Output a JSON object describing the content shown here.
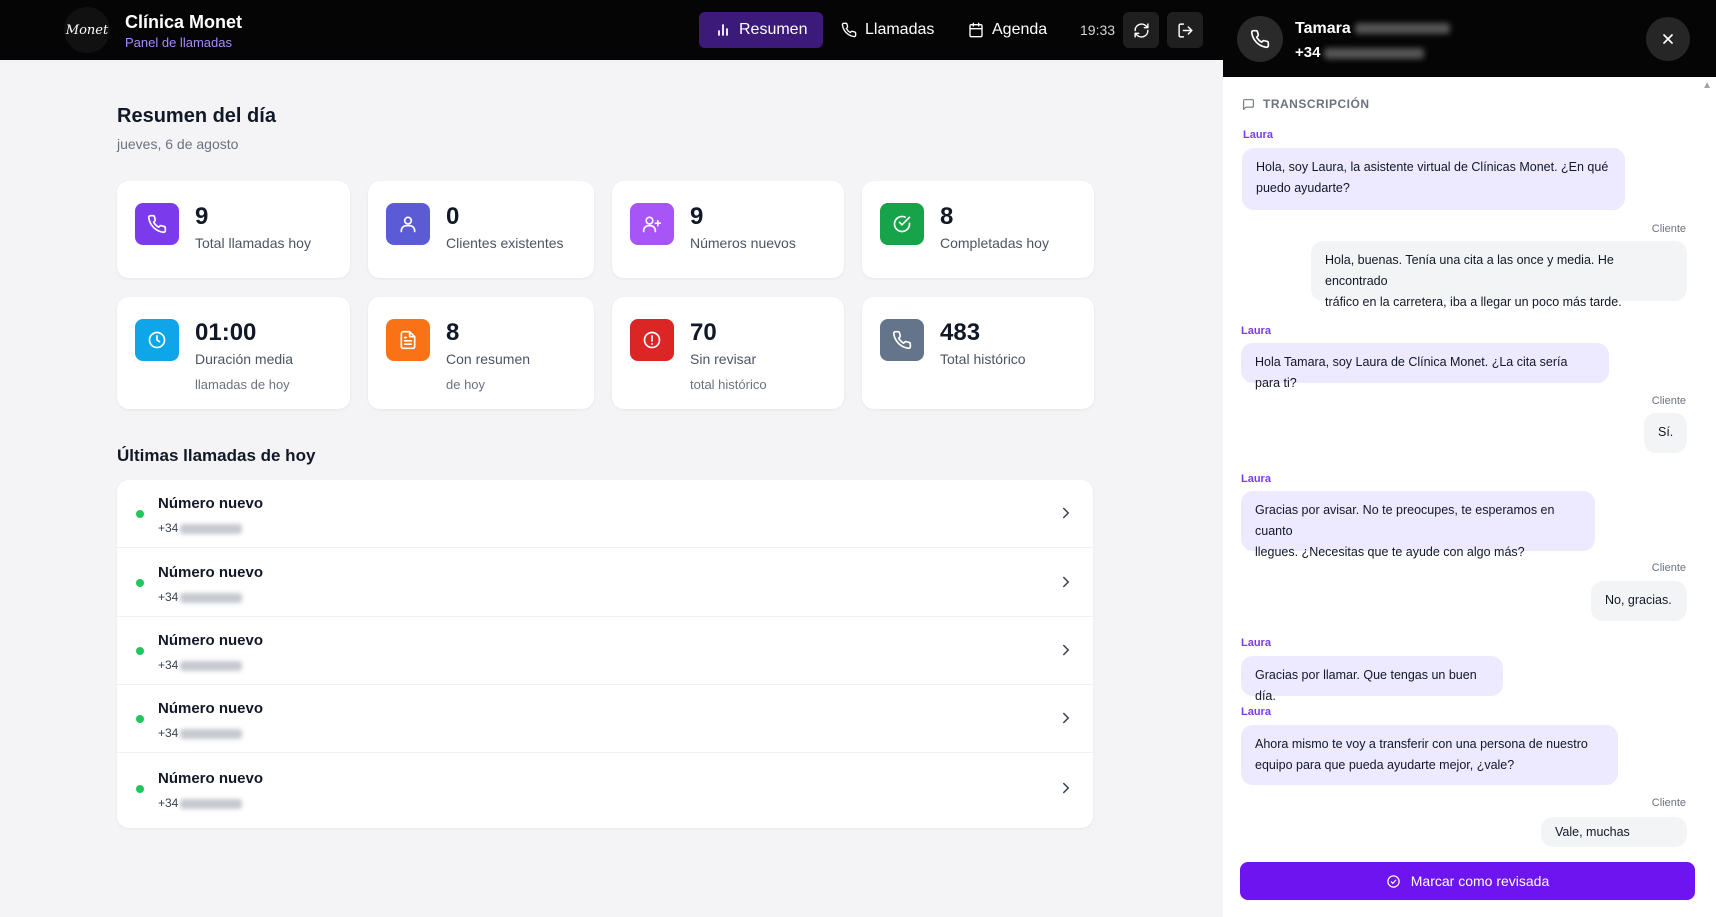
{
  "header": {
    "logo_text": "Monet",
    "app_title": "Clínica Monet",
    "subtitle": "Panel de llamadas",
    "nav": [
      {
        "label": "Resumen",
        "icon": "bar-chart-icon"
      },
      {
        "label": "Llamadas",
        "icon": "phone-icon"
      },
      {
        "label": "Agenda",
        "icon": "calendar-icon"
      }
    ],
    "time": "19:33",
    "active_color": "#3b1a7a"
  },
  "summary": {
    "title": "Resumen del día",
    "date": "jueves, 6 de agosto",
    "stats": [
      {
        "value": "9",
        "label": "Total llamadas hoy",
        "sub": "",
        "icon": "phone-icon",
        "color": "#7c3aed"
      },
      {
        "value": "0",
        "label": "Clientes existentes",
        "sub": "",
        "icon": "user-icon",
        "color": "#5b5bd6"
      },
      {
        "value": "9",
        "label": "Números nuevos",
        "sub": "",
        "icon": "user-plus-icon",
        "color": "#a855f7"
      },
      {
        "value": "8",
        "label": "Completadas hoy",
        "sub": "",
        "icon": "check-circle-icon",
        "color": "#16a34a"
      },
      {
        "value": "01:00",
        "label": "Duración media",
        "sub": "llamadas de hoy",
        "icon": "clock-icon",
        "color": "#0ea5e9"
      },
      {
        "value": "8",
        "label": "Con resumen",
        "sub": "de hoy",
        "icon": "document-icon",
        "color": "#f97316"
      },
      {
        "value": "70",
        "label": "Sin revisar",
        "sub": "total histórico",
        "icon": "alert-icon",
        "color": "#dc2626"
      },
      {
        "value": "483",
        "label": "Total histórico",
        "sub": "",
        "icon": "phone-icon",
        "color": "#64748b"
      }
    ]
  },
  "recent": {
    "title": "Últimas llamadas de hoy",
    "calls": [
      {
        "name": "Número nuevo",
        "prefix": "+34"
      },
      {
        "name": "Número nuevo",
        "prefix": "+34"
      },
      {
        "name": "Número nuevo",
        "prefix": "+34"
      },
      {
        "name": "Número nuevo",
        "prefix": "+34"
      },
      {
        "name": "Número nuevo",
        "prefix": "+34"
      }
    ]
  },
  "panel": {
    "caller_name": "Tamara",
    "caller_phone_prefix": "+34",
    "transcript_label": "TRANSCRIPCIÓN",
    "messages": [
      {
        "speaker": "Laura",
        "role": "bot",
        "lines": [
          "Hola, soy Laura, la asistente virtual de Clínicas Monet. ¿En qué",
          "puedo ayudarte?"
        ]
      },
      {
        "speaker": "Cliente",
        "role": "client",
        "lines": [
          "Hola, buenas. Tenía una cita a las once y media. He encontrado",
          "tráfico en la carretera, iba a llegar un poco más tarde."
        ]
      },
      {
        "speaker": "Laura",
        "role": "bot",
        "lines": [
          "Hola Tamara, soy Laura de Clínica Monet. ¿La cita sería para ti?"
        ]
      },
      {
        "speaker": "Cliente",
        "role": "client",
        "lines": [
          "Sí."
        ]
      },
      {
        "speaker": "Laura",
        "role": "bot",
        "lines": [
          "Gracias por avisar. No te preocupes, te esperamos en cuanto",
          "llegues. ¿Necesitas que te ayude con algo más?"
        ]
      },
      {
        "speaker": "Cliente",
        "role": "client",
        "lines": [
          "No, gracias."
        ]
      },
      {
        "speaker": "Laura",
        "role": "bot",
        "lines": [
          "Gracias por llamar. Que tengas un buen día."
        ]
      },
      {
        "speaker": "Laura",
        "role": "bot",
        "lines": [
          "Ahora mismo te voy a transferir con una persona de nuestro",
          "equipo para que pueda ayudarte mejor, ¿vale?"
        ]
      },
      {
        "speaker": "Cliente",
        "role": "client",
        "lines": [
          "Vale, muchas gracias."
        ]
      }
    ],
    "review_button": "Marcar como revisada",
    "accent": "#6d14f0"
  }
}
